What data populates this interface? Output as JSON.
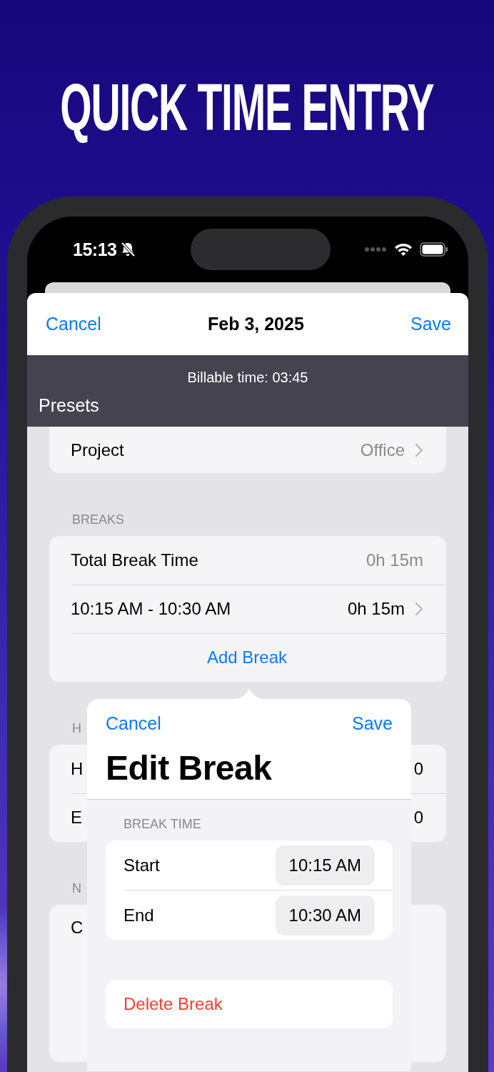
{
  "headline": "QUICK TIME ENTRY",
  "status_bar": {
    "time": "15:13",
    "silent": true
  },
  "sheet": {
    "nav": {
      "cancel": "Cancel",
      "title": "Feb 3, 2025",
      "save": "Save"
    },
    "banner": {
      "billable": "Billable time: 03:45",
      "section": "Presets"
    },
    "sections": [
      {
        "rows": [
          {
            "kind": "detail",
            "label": "Project",
            "value": "Office"
          }
        ]
      },
      {
        "header": "BREAKS",
        "rows": [
          {
            "kind": "value",
            "label": "Total Break Time",
            "value": "0h 15m"
          },
          {
            "kind": "link",
            "label": "10:15 AM - 10:30 AM",
            "value": "0h 15m"
          },
          {
            "kind": "action",
            "label": "Add Break"
          }
        ]
      },
      {
        "header": "H",
        "rows": [
          {
            "kind": "plain",
            "label": "H",
            "value": "0"
          },
          {
            "kind": "plain",
            "label": "E",
            "value": "0"
          }
        ]
      },
      {
        "header": "N",
        "rows": [
          {
            "kind": "note",
            "label": "C"
          }
        ]
      }
    ]
  },
  "popover": {
    "cancel": "Cancel",
    "save": "Save",
    "title": "Edit Break",
    "section_header": "BREAK TIME",
    "fields": [
      {
        "label": "Start",
        "value": "10:15 AM"
      },
      {
        "label": "End",
        "value": "10:30 AM"
      }
    ],
    "delete": "Delete Break"
  }
}
